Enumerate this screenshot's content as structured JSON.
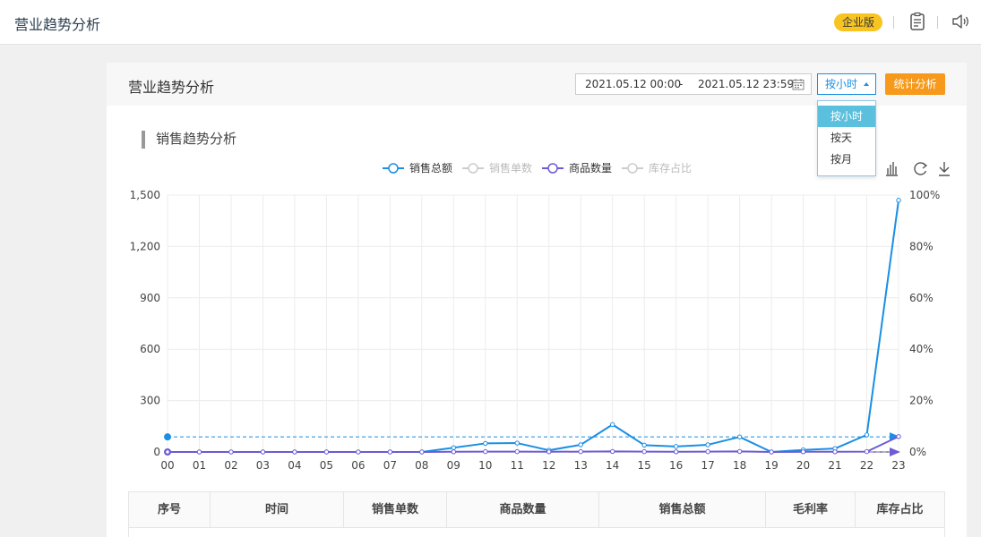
{
  "header": {
    "title": "营业趋势分析",
    "badge": "企业版",
    "icons": [
      "clipboard-icon",
      "speaker-icon"
    ]
  },
  "panel": {
    "title": "营业趋势分析",
    "date_start": "2021.05.12 00:00",
    "date_separator": "-",
    "date_end": "2021.05.12 23:59",
    "group_select": "按小时",
    "group_options": [
      "按小时",
      "按天",
      "按月"
    ],
    "stat_button": "统计分析",
    "section_title": "销售趋势分析"
  },
  "colors": {
    "accent": "#1a8fe3",
    "primary_series": "#1a8fe3",
    "secondary_series": "#6c5bd4",
    "disabled_series": "#cccccc",
    "stat_button": "#f79a1b",
    "badge": "#f8c422",
    "dropdown_active": "#5bc0de"
  },
  "chart_data": {
    "type": "line",
    "x": [
      "00",
      "01",
      "02",
      "03",
      "04",
      "05",
      "06",
      "07",
      "08",
      "09",
      "10",
      "11",
      "12",
      "13",
      "14",
      "15",
      "16",
      "17",
      "18",
      "19",
      "20",
      "21",
      "22",
      "23"
    ],
    "y_left": {
      "ticks": [
        "0",
        "300",
        "600",
        "900",
        "1,200",
        "1,500"
      ],
      "range": [
        0,
        1500
      ]
    },
    "y_right": {
      "ticks": [
        "0%",
        "20%",
        "40%",
        "60%",
        "80%",
        "100%"
      ],
      "range": [
        0,
        100
      ]
    },
    "legend": [
      {
        "name": "销售总额",
        "active": true
      },
      {
        "name": "销售单数",
        "active": false
      },
      {
        "name": "商品数量",
        "active": true
      },
      {
        "name": "库存占比",
        "active": false
      }
    ],
    "legend_position": "top-center",
    "grid": true,
    "series": [
      {
        "name": "销售总额",
        "values": [
          0,
          0,
          0,
          0,
          0,
          0,
          0,
          0,
          0,
          25,
          50,
          52,
          10,
          42,
          160,
          40,
          32,
          42,
          88,
          0,
          12,
          20,
          100,
          1470
        ]
      },
      {
        "name": "商品数量",
        "values": [
          0,
          0,
          0,
          0,
          0,
          0,
          0,
          0,
          0,
          1,
          2,
          2,
          1,
          2,
          3,
          2,
          1,
          2,
          3,
          0,
          1,
          1,
          2,
          90
        ]
      }
    ],
    "average_markline": 88,
    "toolbox": [
      "bar-chart-icon",
      "refresh-icon",
      "download-icon"
    ]
  },
  "table": {
    "headers": [
      "序号",
      "时间",
      "销售单数",
      "商品数量",
      "销售总额",
      "毛利率",
      "库存占比"
    ]
  }
}
